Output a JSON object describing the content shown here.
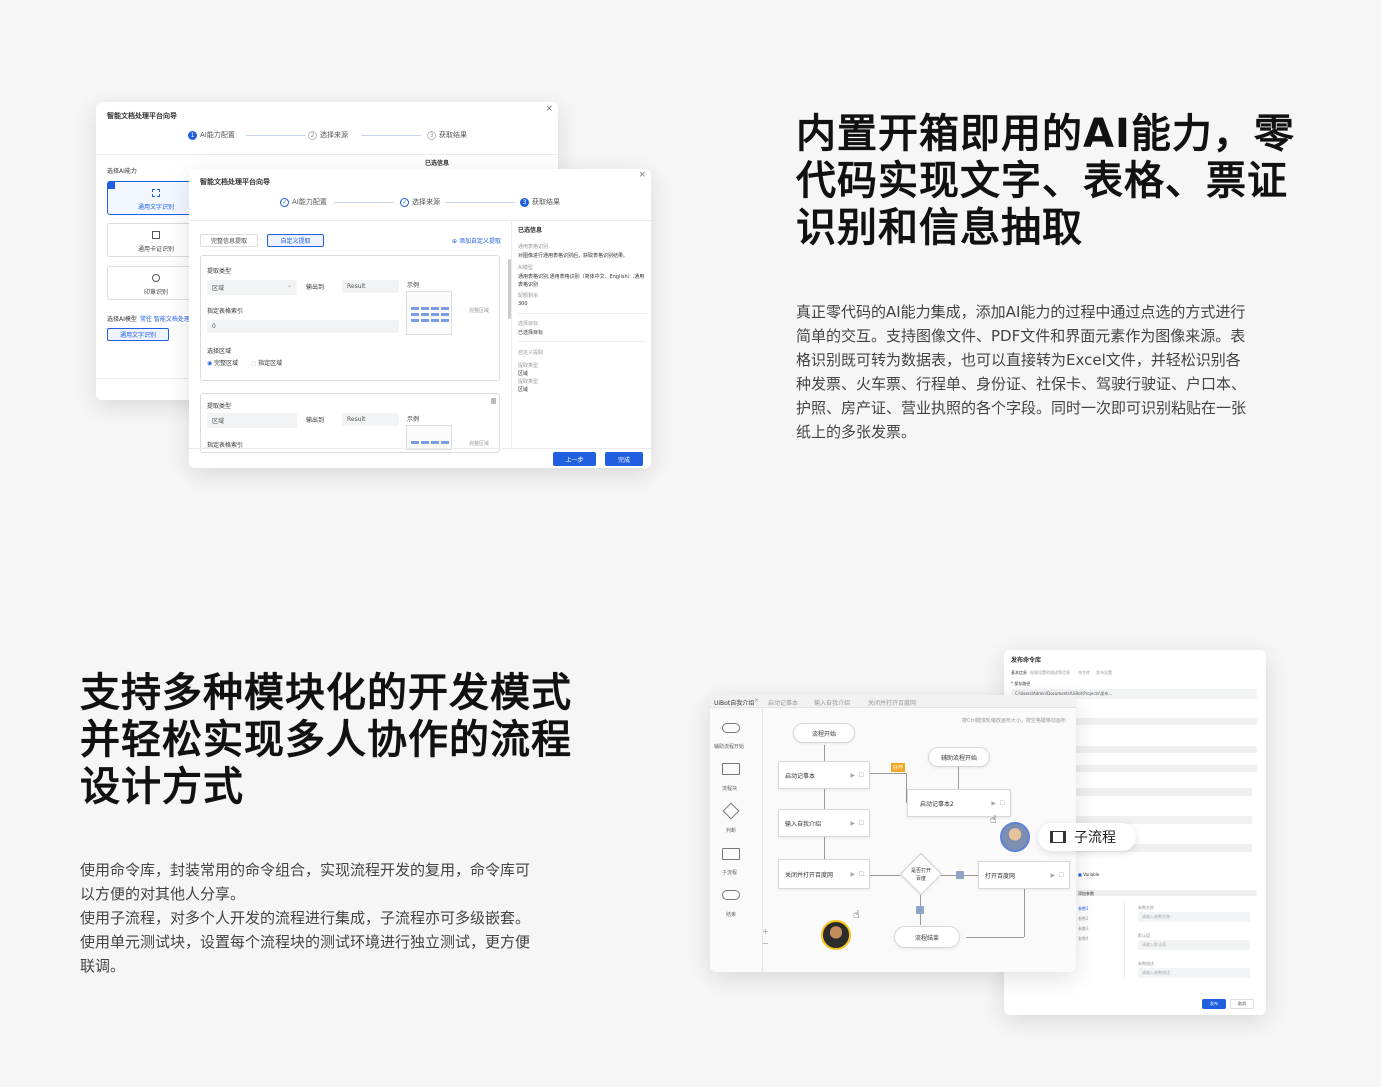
{
  "section1": {
    "headline": [
      "内置开箱即用的AI能力，零",
      "代码实现文字、表格、票证",
      "识别和信息抽取"
    ],
    "paragraph": [
      "真正零代码的AI能力集成，添加AI能力的过程中通过点选的方式进行",
      "简单的交互。支持图像文件、PDF文件和界面元素作为图像来源。表",
      "格识别既可转为数据表，也可以直接转为Excel文件，并轻松识别各",
      "种发票、火车票、行程单、身份证、社保卡、驾驶行驶证、户口本、",
      "护照、房产证、营业执照的各个字段。同时一次即可识别粘贴在一张",
      "纸上的多张发票。"
    ]
  },
  "section2": {
    "headline": [
      "支持多种模块化的开发模式",
      "并轻松实现多人协作的流程",
      "设计方式"
    ],
    "paragraph": [
      "使用命令库，封装常用的命令组合，实现流程开发的复用，命令库可",
      "以方便的对其他人分享。",
      "使用子流程，对多个人开发的流程进行集成，子流程亦可多级嵌套。",
      "使用单元测试块，设置每个流程块的测试环境进行独立测试，更方便",
      "联调。"
    ]
  },
  "wizard_back": {
    "title": "智能文档处理平台向导",
    "close": "×",
    "steps": [
      "AI能力配置",
      "选择来源",
      "获取结果"
    ],
    "step_nums": [
      "1",
      "2",
      "3"
    ],
    "section_label": "选择AI能力",
    "options": [
      "通用文字识别",
      "通用卡证识别",
      "印章识别"
    ],
    "selected_label": "已选信息",
    "model_label": "选择AI模型",
    "model_link": "常往 智能文档处理平",
    "model_button": "通用文字识别"
  },
  "wizard_front": {
    "title": "智能文档处理平台向导",
    "close": "×",
    "steps": [
      "AI能力配置",
      "选择来源",
      "获取结果"
    ],
    "step_nums": [
      "✓",
      "✓",
      "3"
    ],
    "tabs": [
      "完整信息提取",
      "自定义提取"
    ],
    "add_custom": "添加自定义提取",
    "block1": {
      "type_label": "提取类型",
      "type_value": "区域",
      "output_label": "输出到",
      "output_value": "Result",
      "example_label": "示例",
      "index_label": "指定表格索引",
      "index_value": "0",
      "area_label": "选择区域",
      "radio_full": "完整区域",
      "radio_custom": "指定区域",
      "callout": "完整区域"
    },
    "block2": {
      "type_label": "提取类型",
      "type_value": "区域",
      "output_label": "输出到",
      "output_value": "Result",
      "example_label": "示例",
      "index_label": "指定表格索引",
      "callout": "完整区域"
    },
    "side": {
      "title": "已选信息",
      "items": [
        {
          "label": "通用表格识别",
          "value": "对图像进行通用表格识别后，获取表格识别结果。"
        },
        {
          "label": "AI模型",
          "value": "通用表格识别,通用表格识别（简体中文、English）,通用表格识别"
        },
        {
          "label": "配额剩余",
          "value": "300"
        },
        {
          "label": "选择目标",
          "value": "已选择目标"
        },
        {
          "label": "自定义提取",
          "value": ""
        },
        {
          "label": "提取类型",
          "value": "区域"
        },
        {
          "label": "提取类型",
          "value": "区域"
        }
      ]
    },
    "btn_prev": "上一步",
    "btn_done": "完成"
  },
  "flow_editor": {
    "tabs": [
      "UiBot自我介绍",
      "启动记事本",
      "输入自我介绍",
      "关闭并打开百度网"
    ],
    "tab_close": "×",
    "hint": "按Ctrl键滚轮缩放画布大小，按空格键移动画布",
    "sidebar": [
      "辅助流程开始",
      "流程块",
      "判断",
      "子流程",
      "结束"
    ],
    "nodes": {
      "start": "流程开始",
      "n1": "启动记事本",
      "n2": "输入自我介绍",
      "n3": "关闭并打开百度网",
      "helper": "辅助流程开始",
      "n4": "启动记事本2",
      "decision": "是否打开百度",
      "n5": "打开百度网",
      "end": "流程结束",
      "badge": "好坏"
    },
    "zoom": [
      "+",
      "−"
    ],
    "subflow_tag": "子流程"
  },
  "publish_dialog": {
    "title": "发布命令库",
    "tabs": [
      "基本信息",
      "权限设置的描述等信息",
      "命令库",
      "发布设置"
    ],
    "path_label": "* 保存路径",
    "path_value": "C:\\Users\\Admin\\Documents\\UiBot\\Projects\\发布...",
    "check_label": "Variable",
    "section_label": "添加参数",
    "list": [
      "参数1",
      "参数2",
      "参数3",
      "参数4"
    ],
    "field_labels": [
      "参数名称",
      "默认值",
      "参数描述"
    ],
    "placeholders": [
      "请输入参数名称",
      "请输入默认值",
      "请输入参数描述"
    ],
    "btn_ok": "发布",
    "btn_cancel": "取消"
  },
  "colors": {
    "accent": "#1f5fe0",
    "orange": "#f5a623"
  }
}
